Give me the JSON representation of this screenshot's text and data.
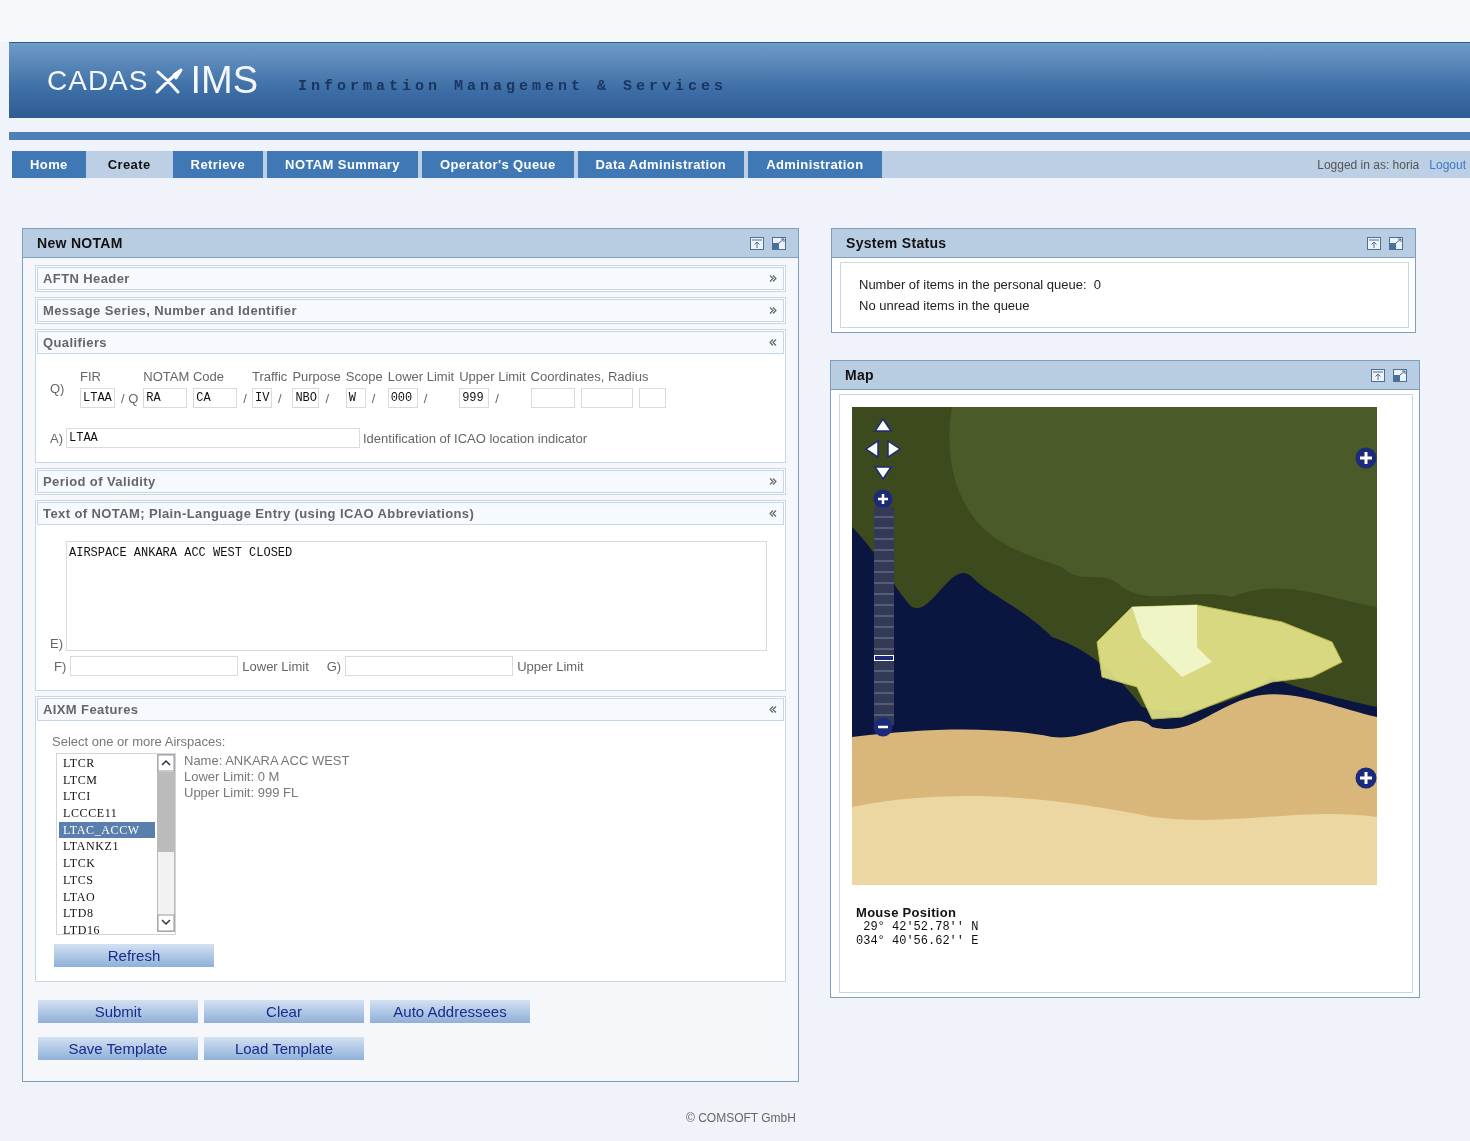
{
  "header": {
    "logo_left": "CADAS",
    "logo_right": "IMS",
    "tagline": "Information Management & Services"
  },
  "nav": {
    "tabs": [
      {
        "label": "Home",
        "selected": false
      },
      {
        "label": "Create",
        "selected": true
      },
      {
        "label": "Retrieve",
        "selected": false
      },
      {
        "label": "NOTAM Summary",
        "selected": false
      },
      {
        "label": "Operator's Queue",
        "selected": false
      },
      {
        "label": "Data Administration",
        "selected": false
      },
      {
        "label": "Administration",
        "selected": false
      }
    ],
    "user_label": "Logged in as: horia",
    "logout": "Logout"
  },
  "new_notam": {
    "title": "New NOTAM",
    "sections": [
      {
        "kind": "plain",
        "title": "AFTN Header",
        "expanded": false
      },
      {
        "kind": "plain",
        "title": "Message Series, Number and Identifier",
        "expanded": false
      },
      {
        "kind": "qualifiers",
        "title": "Qualifiers",
        "expanded": true,
        "q_label": "Q)",
        "columns": [
          {
            "heading": "FIR",
            "items": [
              {
                "kind": "field",
                "value": "LTAA"
              },
              {
                "kind": "label",
                "text": "/ Q"
              }
            ]
          },
          {
            "heading": "NOTAM Code",
            "items": [
              {
                "kind": "field",
                "value": "RA"
              },
              {
                "kind": "field",
                "value": "CA"
              },
              {
                "kind": "label",
                "text": "/"
              }
            ]
          },
          {
            "heading": "Traffic",
            "items": [
              {
                "kind": "field",
                "value": "IV"
              },
              {
                "kind": "label",
                "text": "/"
              }
            ]
          },
          {
            "heading": "Purpose",
            "items": [
              {
                "kind": "field",
                "value": "NBO"
              },
              {
                "kind": "label",
                "text": "/"
              }
            ]
          },
          {
            "heading": "Scope",
            "items": [
              {
                "kind": "field",
                "value": "W"
              },
              {
                "kind": "label",
                "text": "/"
              }
            ]
          },
          {
            "heading": "Lower Limit",
            "items": [
              {
                "kind": "field",
                "value": "000"
              },
              {
                "kind": "label",
                "text": "/"
              }
            ]
          },
          {
            "heading": "Upper Limit",
            "items": [
              {
                "kind": "field",
                "value": "999"
              },
              {
                "kind": "label",
                "text": "/"
              }
            ]
          },
          {
            "heading": "Coordinates, Radius",
            "items": [
              {
                "kind": "field",
                "value": ""
              },
              {
                "kind": "field",
                "value": ""
              },
              {
                "kind": "field",
                "value": ""
              }
            ]
          }
        ],
        "a_label": "A)",
        "a_value": "LTAA",
        "a_hint": "Identification of ICAO location indicator"
      },
      {
        "kind": "plain",
        "title": "Period of Validity",
        "expanded": false
      },
      {
        "kind": "text",
        "title": "Text of NOTAM; Plain-Language Entry (using ICAO Abbreviations)",
        "expanded": true,
        "e_label": "E)",
        "e_value": "AIRSPACE ANKARA ACC WEST CLOSED",
        "f_label": "F)",
        "f_hint": "Lower Limit",
        "g_label": "G)",
        "g_hint": "Upper Limit"
      },
      {
        "kind": "aixm",
        "title": "AIXM Features",
        "expanded": true,
        "prompt": "Select one or more Airspaces:",
        "airspaces": [
          {
            "label": "LTCR",
            "selected": false
          },
          {
            "label": "LTCM",
            "selected": false
          },
          {
            "label": "LTCI",
            "selected": false
          },
          {
            "label": "LCCCE11",
            "selected": false
          },
          {
            "label": "LTAC_ACCW",
            "selected": true
          },
          {
            "label": "LTANKZ1",
            "selected": false
          },
          {
            "label": "LTCK",
            "selected": false
          },
          {
            "label": "LTCS",
            "selected": false
          },
          {
            "label": "LTAO",
            "selected": false
          },
          {
            "label": "LTD8",
            "selected": false
          },
          {
            "label": "LTD16",
            "selected": false
          }
        ],
        "details": [
          "Name: ANKARA ACC WEST",
          "Lower Limit: 0 M",
          "Upper Limit: 999 FL"
        ],
        "refresh": "Refresh"
      }
    ],
    "button_rows": [
      [
        "Submit",
        "Clear",
        "Auto Addressees"
      ],
      [
        "Save Template",
        "Load Template"
      ]
    ]
  },
  "system_status": {
    "title": "System Status",
    "lines": [
      "Number of items in the personal queue:  0",
      "No unread items in the queue"
    ]
  },
  "map": {
    "title": "Map",
    "zoom": {
      "level": 0.3
    },
    "mouse_position_title": "Mouse Position",
    "coordinates": [
      " 29° 42'52.78'' N",
      "034° 40'56.62'' E"
    ]
  },
  "footer": "© COMSOFT GmbH"
}
